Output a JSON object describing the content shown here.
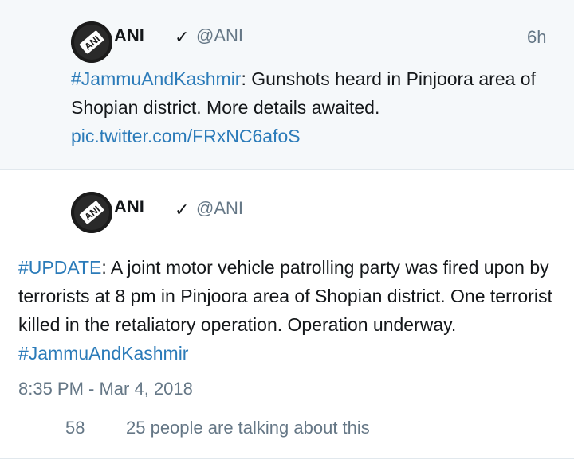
{
  "parent_tweet": {
    "author_name": "ANI",
    "verified_glyph": "✓",
    "handle": "@ANI",
    "time_ago": "6h",
    "text_parts": {
      "hashtag": "#JammuAndKashmir",
      "body": ": Gunshots heard in Pinjoora area of Shopian district. More details awaited.",
      "link": "pic.twitter.com/FRxNC6afoS"
    },
    "avatar_icon": "ani-logo-icon"
  },
  "main_tweet": {
    "author_name": "ANI",
    "verified_glyph": "✓",
    "handle": "@ANI",
    "text_parts": {
      "hashtag_lead": "#UPDATE",
      "body": ": A joint motor vehicle patrolling party was fired upon by terrorists at 8 pm in Pinjoora area of Shopian district. One terrorist killed in the retaliatory operation. Operation underway. ",
      "hashtag_tail": "#JammuAndKashmir"
    },
    "timestamp": "8:35 PM - Mar 4, 2018",
    "likes_count": "58",
    "talking_text": "25 people are talking about this",
    "avatar_icon": "ani-logo-icon"
  },
  "colors": {
    "link": "#2b7bb9",
    "muted": "#657786",
    "parent_bg": "#f5f8fa",
    "text": "#14171a"
  }
}
